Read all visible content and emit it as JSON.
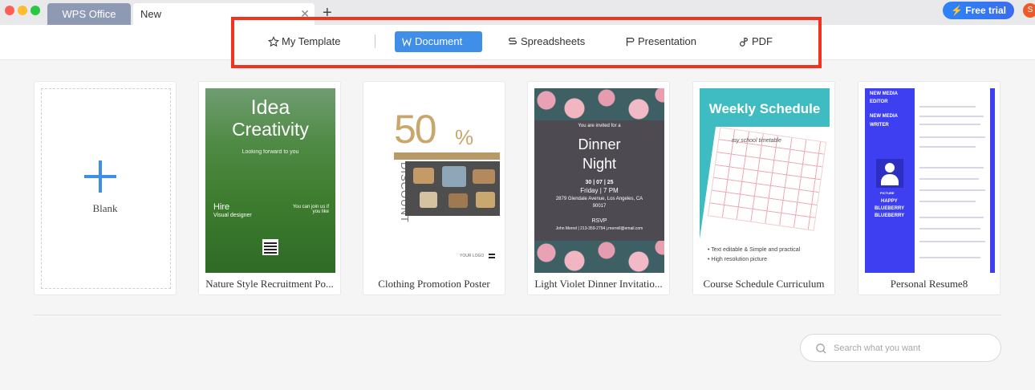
{
  "titlebar": {
    "tabs": [
      {
        "label": "WPS Office"
      },
      {
        "label": "New"
      }
    ],
    "free_trial": "Free trial",
    "avatar_initial": "S"
  },
  "categories": [
    {
      "label": "My Template",
      "icon": "star-icon"
    },
    {
      "label": "Document",
      "icon": "document-icon",
      "active": true
    },
    {
      "label": "Spreadsheets",
      "icon": "spreadsheet-icon"
    },
    {
      "label": "Presentation",
      "icon": "presentation-icon"
    },
    {
      "label": "PDF",
      "icon": "pdf-icon"
    }
  ],
  "accent_color": "#3f8fe8",
  "highlight_color": "#f23320",
  "templates": {
    "blank": {
      "label": "Blank"
    },
    "nature": {
      "title": "Nature Style Recruitment Po...",
      "line1": "Idea",
      "line2": "Creativity",
      "sub": "Looking forward to you",
      "hire": "Hire",
      "role": "Visual designer",
      "join": "You can join us if you like"
    },
    "clothing": {
      "title": "Clothing Promotion Poster",
      "big": "50",
      "pct": "%",
      "discount": "DISCOUNT",
      "logo": "YOUR LOGO"
    },
    "dinner": {
      "title": "Light Violet Dinner Invitatio...",
      "invited": "You are invited for a",
      "line1": "Dinner",
      "line2": "Night",
      "date": "30 | 07 | 25",
      "time": "Friday | 7 PM",
      "address": "2879 Glendale Avenue, Los Angeles, CA 90017",
      "rsvp": "RSVP",
      "contact": "John Merrel | 213-359-2794 j.merrell@email.com"
    },
    "schedule": {
      "title": "Course Schedule Curriculum",
      "heading": "Weekly Schedule",
      "caption": "my school timetable",
      "tip1": "• Text editable & Simple and practical",
      "tip2": "• High resolution picture"
    },
    "resume": {
      "title": "Personal Resume8",
      "l1": "NEW MEDIA",
      "l2": "EDITOR",
      "l3": "NEW MEDIA",
      "l4": "WRITER",
      "picture": "PICTURE",
      "n1": "HAPPY",
      "n2": "BLUEBERRY",
      "n3": "BLUEBERRY"
    }
  },
  "search": {
    "placeholder": "Search what you want"
  }
}
